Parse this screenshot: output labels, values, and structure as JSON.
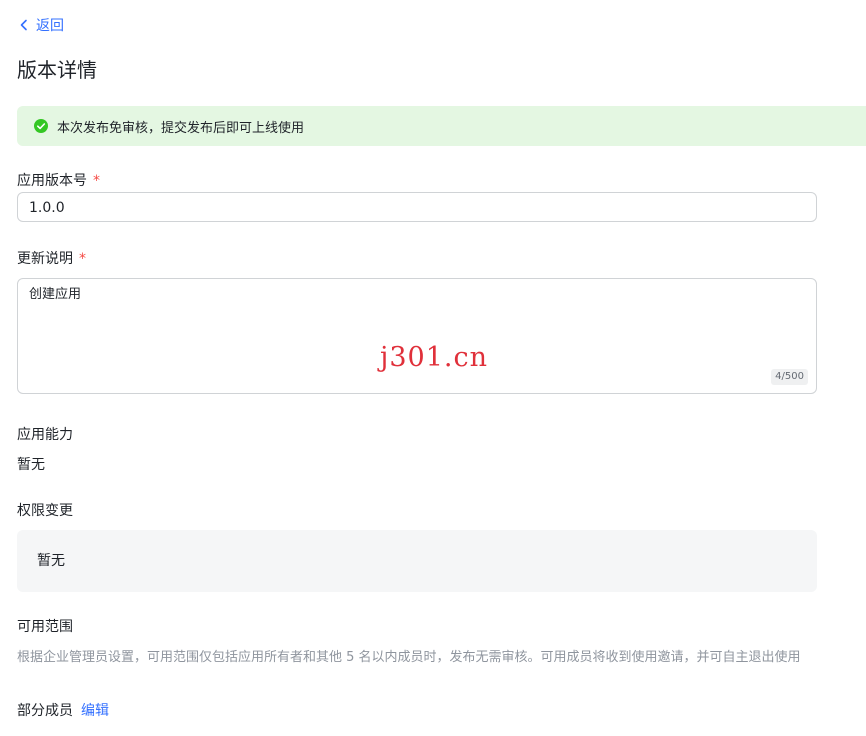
{
  "header": {
    "back_label": "返回",
    "title": "版本详情"
  },
  "notice": {
    "text": "本次发布免审核，提交发布后即可上线使用"
  },
  "version": {
    "label": "应用版本号",
    "required_mark": "*",
    "value": "1.0.0"
  },
  "changelog": {
    "label": "更新说明",
    "required_mark": "*",
    "value": "创建应用",
    "counter": "4/500"
  },
  "watermark": "j301.cn",
  "capability": {
    "label": "应用能力",
    "value": "暂无"
  },
  "permissions": {
    "label": "权限变更",
    "value": "暂无"
  },
  "scope": {
    "label": "可用范围",
    "description": "根据企业管理员设置，可用范围仅包括应用所有者和其他 5 名以内成员时，发布无需审核。可用成员将收到使用邀请，并可自主退出使用",
    "members_label": "部分成员",
    "edit_label": "编辑"
  },
  "colors": {
    "accent": "#3370ff",
    "success": "#34c724",
    "required": "#f54a45",
    "notice_bg": "#e4f7e2"
  }
}
